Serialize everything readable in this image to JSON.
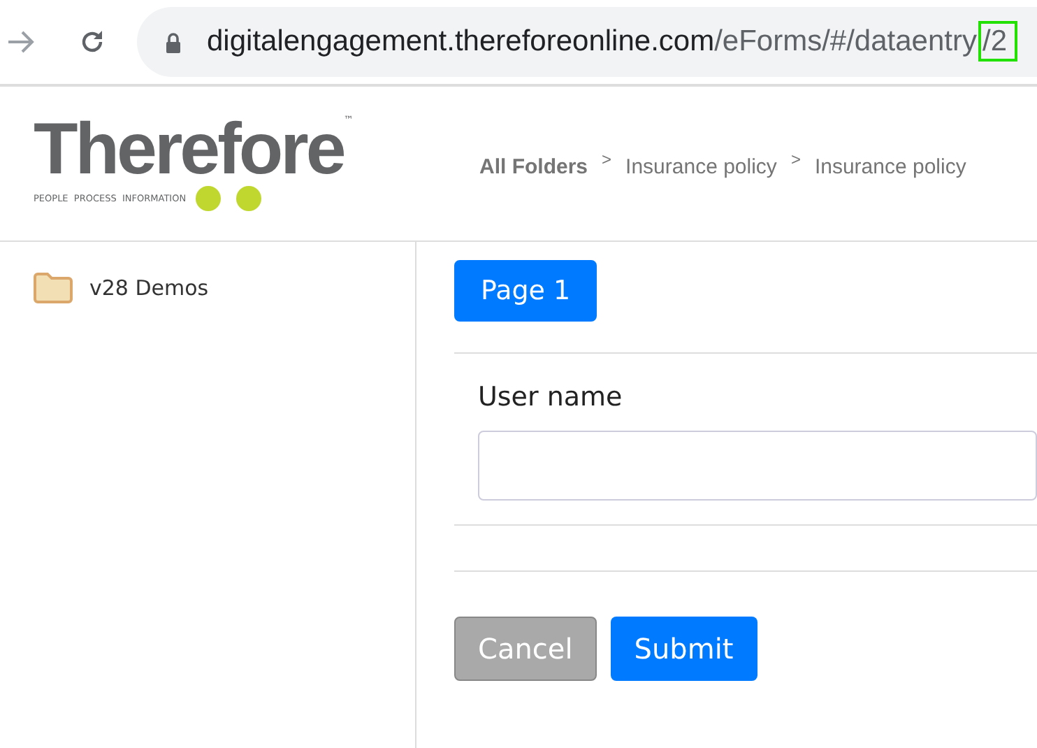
{
  "browser": {
    "url_host": "digitalengagement.thereforeonline.com",
    "url_path": "/eForms/#/dataentry",
    "url_highlight": "/2"
  },
  "logo": {
    "word": "Therefore",
    "trademark": "™",
    "tagline": "PEOPLE  PROCESS  INFORMATION"
  },
  "breadcrumb": [
    {
      "label": "All Folders"
    },
    {
      "label": "Insurance policy"
    },
    {
      "label": "Insurance policy"
    }
  ],
  "breadcrumb_separator": ">",
  "sidebar": {
    "items": [
      {
        "label": "v28 Demos",
        "selected": false
      }
    ]
  },
  "pages": [
    {
      "label": "Page 1",
      "selected": true
    }
  ],
  "form": {
    "fields": [
      {
        "label": "User name"
      }
    ]
  },
  "buttons": [
    {
      "label": "Cancel",
      "kind": "secondary",
      "disabled": true
    },
    {
      "label": "Submit",
      "kind": "primary",
      "disabled": false
    }
  ]
}
